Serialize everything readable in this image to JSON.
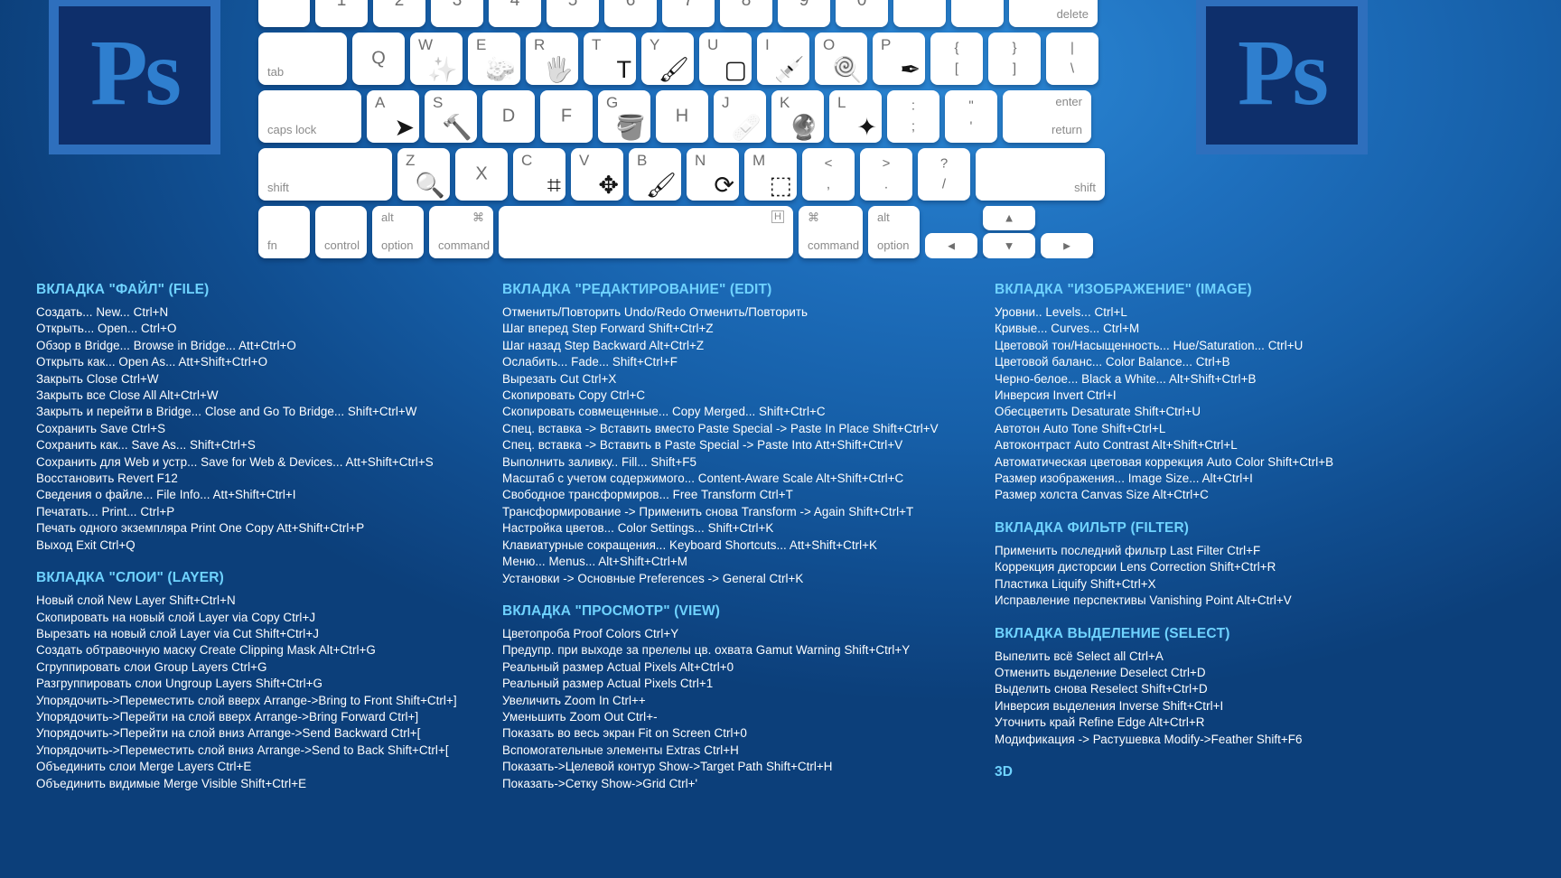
{
  "brand": {
    "logo_text": "Ps",
    "accent": "#6fd3ff",
    "logo_bg": "#0e2f6b",
    "logo_frame": "#2e6fbd"
  },
  "keyboard": {
    "rows": [
      [
        {
          "name": "esc",
          "type": "blank",
          "w": "w-fn"
        },
        {
          "name": "1",
          "type": "num",
          "label": "1"
        },
        {
          "name": "2",
          "type": "num",
          "label": "2"
        },
        {
          "name": "3",
          "type": "num",
          "label": "3"
        },
        {
          "name": "4",
          "type": "num",
          "label": "4"
        },
        {
          "name": "5",
          "type": "num",
          "label": "5"
        },
        {
          "name": "6",
          "type": "num",
          "label": "6"
        },
        {
          "name": "7",
          "type": "num",
          "label": "7"
        },
        {
          "name": "8",
          "type": "num",
          "label": "8"
        },
        {
          "name": "9",
          "type": "num",
          "label": "9"
        },
        {
          "name": "0",
          "type": "num",
          "label": "0"
        },
        {
          "name": "minus",
          "type": "num",
          "label": ""
        },
        {
          "name": "equals",
          "type": "num",
          "label": ""
        },
        {
          "name": "delete",
          "type": "mod-r",
          "label": "delete",
          "w": "w-del"
        }
      ],
      [
        {
          "name": "tab",
          "type": "mod",
          "label": "tab",
          "w": "w-tab"
        },
        {
          "name": "q",
          "type": "ltr-c",
          "label": "Q"
        },
        {
          "name": "w-magic-wand",
          "type": "tool",
          "label": "W",
          "icon": "magic-wand-icon",
          "glyph": "✨"
        },
        {
          "name": "e-eraser",
          "type": "tool",
          "label": "E",
          "icon": "eraser-icon",
          "glyph": "🧽"
        },
        {
          "name": "r-hand",
          "type": "tool",
          "label": "R",
          "icon": "hand-icon",
          "glyph": "🖐"
        },
        {
          "name": "t-type",
          "type": "tool",
          "label": "T",
          "icon": "type-tool-icon",
          "glyph": "T"
        },
        {
          "name": "y-history-brush",
          "type": "tool",
          "label": "Y",
          "icon": "history-brush-icon",
          "glyph": "🖌"
        },
        {
          "name": "u-shape",
          "type": "tool",
          "label": "U",
          "icon": "rounded-rectangle-icon",
          "glyph": "▢"
        },
        {
          "name": "i-eyedropper",
          "type": "tool",
          "label": "I",
          "icon": "eyedropper-icon",
          "glyph": "💉"
        },
        {
          "name": "o-dodge",
          "type": "tool",
          "label": "O",
          "icon": "dodge-tool-icon",
          "glyph": "🍭"
        },
        {
          "name": "p-pen",
          "type": "tool",
          "label": "P",
          "icon": "pen-tool-icon",
          "glyph": "✒"
        },
        {
          "name": "bracket-left",
          "type": "dual",
          "label": "{\n["
        },
        {
          "name": "bracket-right",
          "type": "dual",
          "label": "}\n]"
        },
        {
          "name": "backslash",
          "type": "dual",
          "label": "|\n\\"
        }
      ],
      [
        {
          "name": "caps-lock",
          "type": "mod",
          "label": "caps lock",
          "w": "w-caps"
        },
        {
          "name": "a-path-select",
          "type": "tool",
          "label": "A",
          "icon": "path-selection-icon",
          "glyph": "➤"
        },
        {
          "name": "s-stamp",
          "type": "tool",
          "label": "S",
          "icon": "clone-stamp-icon",
          "glyph": "🔨"
        },
        {
          "name": "d",
          "type": "ltr-c",
          "label": "D"
        },
        {
          "name": "f",
          "type": "ltr-c",
          "label": "F"
        },
        {
          "name": "g-gradient",
          "type": "tool",
          "label": "G",
          "icon": "paint-bucket-icon",
          "glyph": "🪣"
        },
        {
          "name": "h",
          "type": "ltr-c",
          "label": "H"
        },
        {
          "name": "j-healing",
          "type": "tool",
          "label": "J",
          "icon": "healing-brush-icon",
          "glyph": "🩹"
        },
        {
          "name": "k-3d",
          "type": "tool",
          "label": "K",
          "icon": "3d-object-icon",
          "glyph": "🔮"
        },
        {
          "name": "l-lasso",
          "type": "tool",
          "label": "L",
          "icon": "lasso-icon",
          "glyph": "✦"
        },
        {
          "name": "semicolon",
          "type": "dual",
          "label": ":\n;"
        },
        {
          "name": "quote",
          "type": "dual",
          "label": "\"\n'"
        },
        {
          "name": "return",
          "type": "ret",
          "label": "enter",
          "label2": "return",
          "w": "w-ret"
        }
      ],
      [
        {
          "name": "shift-left",
          "type": "mod",
          "label": "shift",
          "w": "w-shiftL"
        },
        {
          "name": "z-zoom",
          "type": "tool",
          "label": "Z",
          "icon": "zoom-icon",
          "glyph": "🔍"
        },
        {
          "name": "x",
          "type": "ltr-c",
          "label": "X"
        },
        {
          "name": "c-crop",
          "type": "tool",
          "label": "C",
          "icon": "crop-icon",
          "glyph": "⌗"
        },
        {
          "name": "v-move",
          "type": "tool",
          "label": "V",
          "icon": "move-tool-icon",
          "glyph": "✥"
        },
        {
          "name": "b-brush",
          "type": "tool",
          "label": "B",
          "icon": "brush-icon",
          "glyph": "🖌"
        },
        {
          "name": "n-notes",
          "type": "tool",
          "label": "N",
          "icon": "note-tool-icon",
          "glyph": "⟳"
        },
        {
          "name": "m-marquee",
          "type": "tool",
          "label": "M",
          "icon": "marquee-icon",
          "glyph": "⬚"
        },
        {
          "name": "comma",
          "type": "dual",
          "label": "<\n,"
        },
        {
          "name": "period",
          "type": "dual",
          "label": ">\n."
        },
        {
          "name": "slash",
          "type": "dual",
          "label": "?\n/"
        },
        {
          "name": "shift-right",
          "type": "mod-r",
          "label": "shift",
          "w": "w-shiftR"
        }
      ],
      [
        {
          "name": "fn",
          "type": "mod",
          "label": "fn",
          "w": "w-fn"
        },
        {
          "name": "control",
          "type": "mod",
          "label": "control",
          "w": "w-ctrl"
        },
        {
          "name": "option-left",
          "type": "modtop",
          "label": "option",
          "top": "alt",
          "w": "w-opt"
        },
        {
          "name": "command-left",
          "type": "modtopr",
          "label": "command",
          "top": "⌘",
          "w": "w-cmd"
        },
        {
          "name": "space",
          "type": "space",
          "label": "H",
          "w": "w-space"
        },
        {
          "name": "command-right",
          "type": "modtl",
          "label": "command",
          "top": "⌘",
          "w": "w-cmd"
        },
        {
          "name": "option-right",
          "type": "modtop",
          "label": "option",
          "top": "alt",
          "w": "w-opt"
        }
      ]
    ],
    "arrows": {
      "up": "▲",
      "down": "▼",
      "left": "◄",
      "right": "►"
    }
  },
  "columns": {
    "file": [
      {
        "title": "ВКЛАДКА \"ФАЙЛ\" (FILE)",
        "rows": [
          "Создать... New...     Ctrl+N",
          "Открыть...         Open...  Ctrl+O",
          "Обзор в Bridge...      Browse in Bridge...  Att+Ctrl+O",
          "Открыть как...    Open As...  Att+Shift+Ctrl+O",
          "Закрыть    Close     Ctrl+W",
          "Закрыть все  Close All    Alt+Ctrl+W",
          "Закрыть и перейти в Bridge... Close and Go To Bridge...    Shift+Ctrl+W",
          "Сохранить    Save    Ctrl+S",
          "Сохранить как...     Save As...  Shift+Ctrl+S",
          "Сохранить для Web и устр...  Save for Web & Devices...   Att+Shift+Ctrl+S",
          "Восстановить    Revert   F12",
          "Сведения о файле... File Info...  Att+Shift+Ctrl+I",
          "Печатать...    Print...   Ctrl+P",
          "Печать одного экземпляра     Print One Copy  Att+Shift+Ctrl+P",
          "Выход  Exit   Ctrl+Q"
        ]
      },
      {
        "title": "ВКЛАДКА \"СЛОИ\" (LAYER)",
        "rows": [
          "Новый слой  New Layer     Shift+Ctrl+N",
          "Скопировать на новый слой   Layer via Copy    Ctrl+J",
          "Вырезать на новый слой    Layer via Cut Shift+Ctrl+J",
          "Создать обтравочную маску  Create Clipping Mask  Alt+Ctrl+G",
          "Сгруппировать слои  Group Layers     Ctrl+G",
          "Разгруппировать слои   Ungroup Layers Shift+Ctrl+G",
          "Упорядочить->Переместить слой вверх Arrange->Bring to Front   Shift+Ctrl+]",
          "Упорядочить->Перейти на слой вверх    Arrange->Bring Forward  Ctrl+]",
          "Упорядочить->Перейти на слой вниз Arrange->Send Backward    Ctrl+[",
          "Упорядочить->Переместить слой вниз   Arrange->Send to Back   Shift+Ctrl+[",
          "Объединить слои  Merge Layers     Ctrl+E",
          "Объединить видимые   Merge Visible Shift+Ctrl+E"
        ]
      }
    ],
    "edit": [
      {
        "title": "ВКЛАДКА \"РЕДАКТИРОВАНИЕ\" (EDIT)",
        "rows": [
          "Отменить/Повторить    Undo/Redo   Отменить/Повторить",
          "Шаг вперед   Step Forward Shift+Ctrl+Z",
          "Шаг назад     Step Backward  Alt+Ctrl+Z",
          "Ослабить...   Fade...  Shift+Ctrl+F",
          "Вырезать  Cut   Ctrl+X",
          "Скопировать Copy    Ctrl+C",
          "Скопировать совмещенные...    Copy Merged...  Shift+Ctrl+C",
          "Спец. вставка -> Вставить вместо  Paste Special -> Paste In Place    Shift+Ctrl+V",
          "Спец. вставка -> Вставить в   Paste Special -> Paste Into  Att+Shift+Ctrl+V",
          "Выполнить заливку.. Fill...  Shift+F5",
          "Масштаб с учетом содержимого...  Content-Aware Scale  Alt+Shift+Ctrl+C",
          "Свободное трансформиров...    Free Transform   Ctrl+T",
          "Трансформирование -> Применить снова  Transform -> Again Shift+Ctrl+T",
          "Настройка цветов...   Color Settings...  Shift+Ctrl+K",
          "Клавиатурные сокращения... Keyboard Shortcuts... Att+Shift+Ctrl+K",
          "Меню...     Menus...   Alt+Shift+Ctrl+M",
          "Установки -> Основные Preferences -> General   Ctrl+K"
        ]
      },
      {
        "title": "ВКЛАДКА \"ПРОСМОТР\" (VIEW)",
        "rows": [
          "Цветопроба  Proof Colors  Ctrl+Y",
          "Предупр. при выходе за прелелы цв. охвата  Gamut Warning  Shift+Ctrl+Y",
          "Реальный размер Actual Pixels  Alt+Ctrl+0",
          "Реальный размер Actual Pixels  Ctrl+1",
          "Увеличить    Zoom In   Ctrl++",
          "Уменьшить   Zoom Out  Ctrl+-",
          "Показать во весь экран Fit on Screen Ctrl+0",
          "Вспомогательные элементы  Extras   Ctrl+H",
          "Показать->Целевой контур    Show->Target Path Shift+Ctrl+H",
          "Показать->Сетку   Show->Grid   Ctrl+'"
        ]
      }
    ],
    "image": [
      {
        "title": "ВКЛАДКА \"ИЗОБРАЖЕНИЕ\" (IMAGE)",
        "rows": [
          "Уровни..   Levels...     Ctrl+L",
          "Кривые...   Curves...   Ctrl+M",
          "Цветовой тон/Насыщенность...  Hue/Saturation...    Ctrl+U",
          "Цветовой баланс...    Color Balance... Ctrl+B",
          "Черно-белое...  Black a White...  Alt+Shift+Ctrl+B",
          "Инверсия Invert    Ctrl+I",
          "Обесцветить    Desaturate    Shift+Ctrl+U",
          "Автотон   Auto Tone Shift+Ctrl+L",
          "Автоконтраст   Auto Contrast    Alt+Shift+Ctrl+L",
          "Автоматическая цветовая коррекция Auto Color Shift+Ctrl+B",
          "Размер изображения...  Image Size...  Alt+Ctrl+I",
          "Размер холста  Canvas Size  Alt+Ctrl+C"
        ]
      },
      {
        "title": "ВКЛАДКА ФИЛЬТР (FILTER)",
        "rows": [
          "Применить последний фильтр   Last Filter  Ctrl+F",
          "Коррекция дисторсии     Lens Correction Shift+Ctrl+R",
          "Пластика  Liquify   Shift+Ctrl+X",
          "Исправление перспективы     Vanishing Point  Alt+Ctrl+V"
        ]
      },
      {
        "title": "ВКЛАДКА ВЫДЕЛЕНИЕ (SELECT)",
        "rows": [
          "Выпелить всё   Select all   Ctrl+A",
          "Отменить выделение    Deselect    Ctrl+D",
          "Выделить снова   Reselect   Shift+Ctrl+D",
          "Инверсия выделения    Inverse Shift+Ctrl+I",
          "Уточнить край   Refine Edge   Alt+Ctrl+R",
          "Модификация -> Растушевка    Modify->Feather     Shift+F6"
        ]
      },
      {
        "title": "3D",
        "rows": []
      }
    ]
  }
}
